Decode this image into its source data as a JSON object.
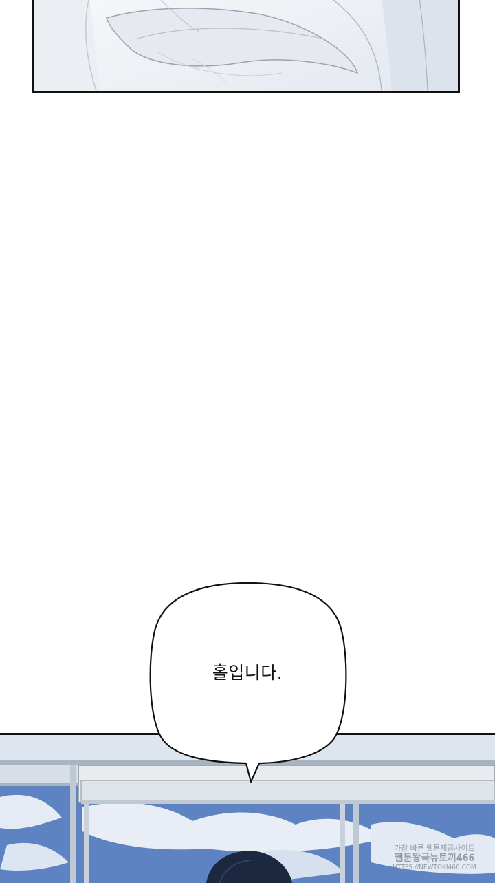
{
  "speech_bubble": {
    "text": "홀입니다."
  },
  "watermark": {
    "line1": "가장 빠른 웹툰제공사이트",
    "line2": "웹툰왕국뉴토끼466",
    "line3": "HTTPS://NEWTOKI466.COM"
  },
  "colors": {
    "panel_border": "#111111",
    "sky": "#5f86c4",
    "cloud": "#e9eef6",
    "window_frame": "#c9d2dc"
  }
}
